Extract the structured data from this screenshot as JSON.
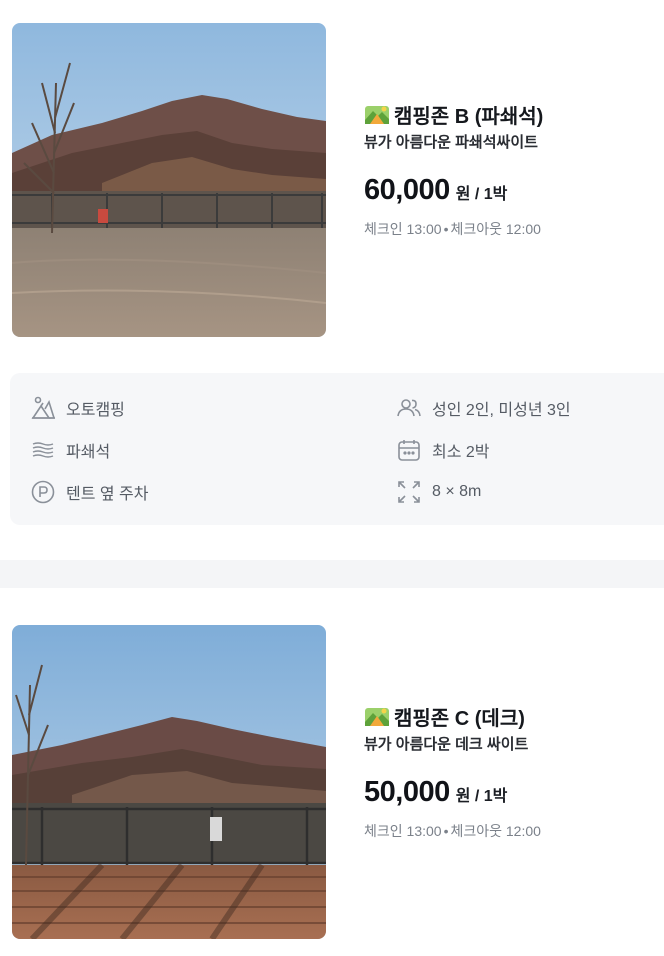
{
  "sites": [
    {
      "title": "캠핑존 B (파쇄석)",
      "subtitle": "뷰가 아름다운 파쇄석싸이트",
      "price": "60,000",
      "price_unit": "원 / 1박",
      "checkin": "체크인 13:00",
      "checkout": "체크아웃 12:00",
      "separator": "•",
      "photo_icon": "mountain-view-photo",
      "title_icon": "camping-emoji-icon"
    },
    {
      "title": "캠핑존 C (데크)",
      "subtitle": "뷰가 아름다운 데크 싸이트",
      "price": "50,000",
      "price_unit": "원 / 1박",
      "checkin": "체크인 13:00",
      "checkout": "체크아웃 12:00",
      "separator": "•",
      "photo_icon": "deck-view-photo",
      "title_icon": "camping-emoji-icon"
    }
  ],
  "features": {
    "type": {
      "label": "오토캠핑",
      "icon": "camping-tent-icon"
    },
    "ground": {
      "label": "파쇄석",
      "icon": "gravel-lines-icon"
    },
    "parking": {
      "label": "텐트 옆 주차",
      "icon": "parking-icon"
    },
    "capacity": {
      "label": "성인 2인, 미성년 3인",
      "icon": "people-icon"
    },
    "min_stay": {
      "label": "최소 2박",
      "icon": "calendar-icon"
    },
    "size": {
      "label": "8 × 8m",
      "icon": "expand-icon"
    }
  },
  "colors": {
    "text_primary": "#15181d",
    "text_muted": "#7b818a",
    "feature_text": "#555b64",
    "feature_bg": "#f6f7f9",
    "divider_bg": "#f4f5f7"
  }
}
